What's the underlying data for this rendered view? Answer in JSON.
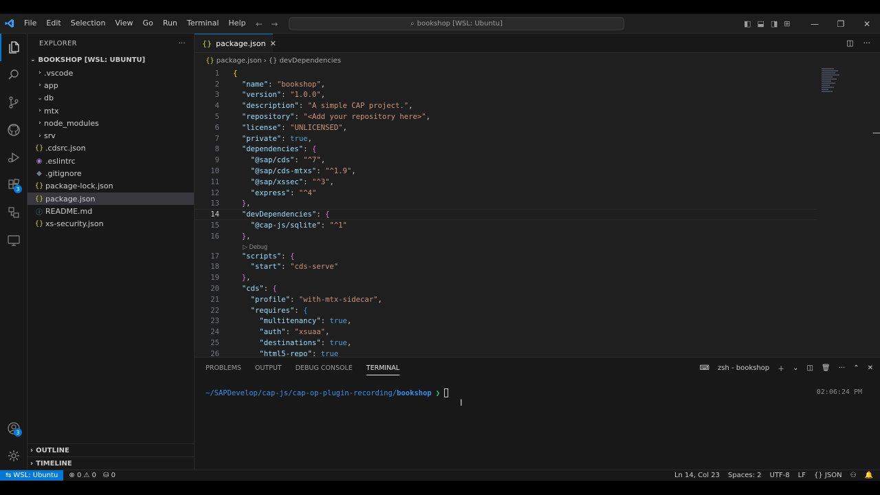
{
  "titlebar": {
    "menu": [
      "File",
      "Edit",
      "Selection",
      "View",
      "Go",
      "Run",
      "Terminal",
      "Help"
    ],
    "search_text": "bookshop [WSL: Ubuntu]"
  },
  "activity": {
    "extensions_badge": "3",
    "accounts_badge": "3"
  },
  "sidebar": {
    "header": "EXPLORER",
    "more": "···",
    "section_title": "BOOKSHOP [WSL: UBUNTU]",
    "items": [
      {
        "label": ".vscode",
        "type": "folder",
        "open": false
      },
      {
        "label": "app",
        "type": "folder",
        "open": false
      },
      {
        "label": "db",
        "type": "folder",
        "open": true
      },
      {
        "label": "mtx",
        "type": "folder",
        "open": false
      },
      {
        "label": "node_modules",
        "type": "folder",
        "open": false
      },
      {
        "label": "srv",
        "type": "folder",
        "open": false
      },
      {
        "label": ".cdsrc.json",
        "type": "json"
      },
      {
        "label": ".eslintrc",
        "type": "eslint"
      },
      {
        "label": ".gitignore",
        "type": "git"
      },
      {
        "label": "package-lock.json",
        "type": "json"
      },
      {
        "label": "package.json",
        "type": "json",
        "selected": true
      },
      {
        "label": "README.md",
        "type": "info"
      },
      {
        "label": "xs-security.json",
        "type": "json"
      }
    ],
    "outline": "OUTLINE",
    "timeline": "TIMELINE"
  },
  "editor": {
    "tab_label": "package.json",
    "breadcrumb": [
      "package.json",
      "devDependencies"
    ],
    "codelens": "Debug",
    "current_line": 14,
    "lines": [
      {
        "n": "1",
        "html": "<span class='br1'>{</span>"
      },
      {
        "n": "2",
        "html": "  <span class='k'>\"name\"</span><span class='p'>: </span><span class='s'>\"bookshop\"</span><span class='p'>,</span>"
      },
      {
        "n": "3",
        "html": "  <span class='k'>\"version\"</span><span class='p'>: </span><span class='s'>\"1.0.0\"</span><span class='p'>,</span>"
      },
      {
        "n": "4",
        "html": "  <span class='k'>\"description\"</span><span class='p'>: </span><span class='s'>\"A simple CAP project.\"</span><span class='p'>,</span>"
      },
      {
        "n": "5",
        "html": "  <span class='k'>\"repository\"</span><span class='p'>: </span><span class='s'>\"&lt;Add your repository here&gt;\"</span><span class='p'>,</span>"
      },
      {
        "n": "6",
        "html": "  <span class='k'>\"license\"</span><span class='p'>: </span><span class='s'>\"UNLICENSED\"</span><span class='p'>,</span>"
      },
      {
        "n": "7",
        "html": "  <span class='k'>\"private\"</span><span class='p'>: </span><span class='b'>true</span><span class='p'>,</span>"
      },
      {
        "n": "8",
        "html": "  <span class='k'>\"dependencies\"</span><span class='p'>: </span><span class='br2'>{</span>"
      },
      {
        "n": "9",
        "html": "    <span class='k'>\"@sap/cds\"</span><span class='p'>: </span><span class='s'>\"^7\"</span><span class='p'>,</span>"
      },
      {
        "n": "10",
        "html": "    <span class='k'>\"@sap/cds-mtxs\"</span><span class='p'>: </span><span class='s'>\"^1.9\"</span><span class='p'>,</span>"
      },
      {
        "n": "11",
        "html": "    <span class='k'>\"@sap/xssec\"</span><span class='p'>: </span><span class='s'>\"^3\"</span><span class='p'>,</span>"
      },
      {
        "n": "12",
        "html": "    <span class='k'>\"express\"</span><span class='p'>: </span><span class='s'>\"^4\"</span>"
      },
      {
        "n": "13",
        "html": "  <span class='br2'>}</span><span class='p'>,</span>"
      },
      {
        "n": "14",
        "html": "  <span class='k'>\"devDependencies\"</span><span class='p'>: </span><span class='br2'>{</span>"
      },
      {
        "n": "15",
        "html": "    <span class='k'>\"@cap-js/sqlite\"</span><span class='p'>: </span><span class='s'>\"^1\"</span>"
      },
      {
        "n": "16",
        "html": "  <span class='br2'>}</span><span class='p'>,</span>"
      },
      {
        "n": "17",
        "html": "  <span class='k'>\"scripts\"</span><span class='p'>: </span><span class='br2'>{</span>"
      },
      {
        "n": "18",
        "html": "    <span class='k'>\"start\"</span><span class='p'>: </span><span class='s'>\"cds-serve\"</span>"
      },
      {
        "n": "19",
        "html": "  <span class='br2'>}</span><span class='p'>,</span>"
      },
      {
        "n": "20",
        "html": "  <span class='k'>\"cds\"</span><span class='p'>: </span><span class='br2'>{</span>"
      },
      {
        "n": "21",
        "html": "    <span class='k'>\"profile\"</span><span class='p'>: </span><span class='s'>\"with-mtx-sidecar\"</span><span class='p'>,</span>"
      },
      {
        "n": "22",
        "html": "    <span class='k'>\"requires\"</span><span class='p'>: </span><span class='br3'>{</span>"
      },
      {
        "n": "23",
        "html": "      <span class='k'>\"multitenancy\"</span><span class='p'>: </span><span class='b'>true</span><span class='p'>,</span>"
      },
      {
        "n": "24",
        "html": "      <span class='k'>\"auth\"</span><span class='p'>: </span><span class='s'>\"xsuaa\"</span><span class='p'>,</span>"
      },
      {
        "n": "25",
        "html": "      <span class='k'>\"destinations\"</span><span class='p'>: </span><span class='b'>true</span><span class='p'>,</span>"
      },
      {
        "n": "26",
        "html": "      <span class='k'>\"html5-repo\"</span><span class='p'>: </span><span class='b'>true</span>"
      }
    ]
  },
  "panel": {
    "tabs": [
      "PROBLEMS",
      "OUTPUT",
      "DEBUG CONSOLE",
      "TERMINAL"
    ],
    "active_tab": "TERMINAL",
    "terminal_name": "zsh - bookshop",
    "prompt_path": "~/SAPDevelop/cap-js/cap-op-plugin-recording/",
    "prompt_dir": "bookshop",
    "prompt_symbol": "❯",
    "time": "02:06:24 PM"
  },
  "statusbar": {
    "remote": "WSL: Ubuntu",
    "errors": "0",
    "warnings": "0",
    "ports": "0",
    "position": "Ln 14, Col 23",
    "spaces": "Spaces: 2",
    "encoding": "UTF-8",
    "eol": "LF",
    "language": "JSON"
  },
  "colors": {
    "accent": "#0078d4",
    "background": "#1f1f1f",
    "sidebar": "#181818"
  }
}
